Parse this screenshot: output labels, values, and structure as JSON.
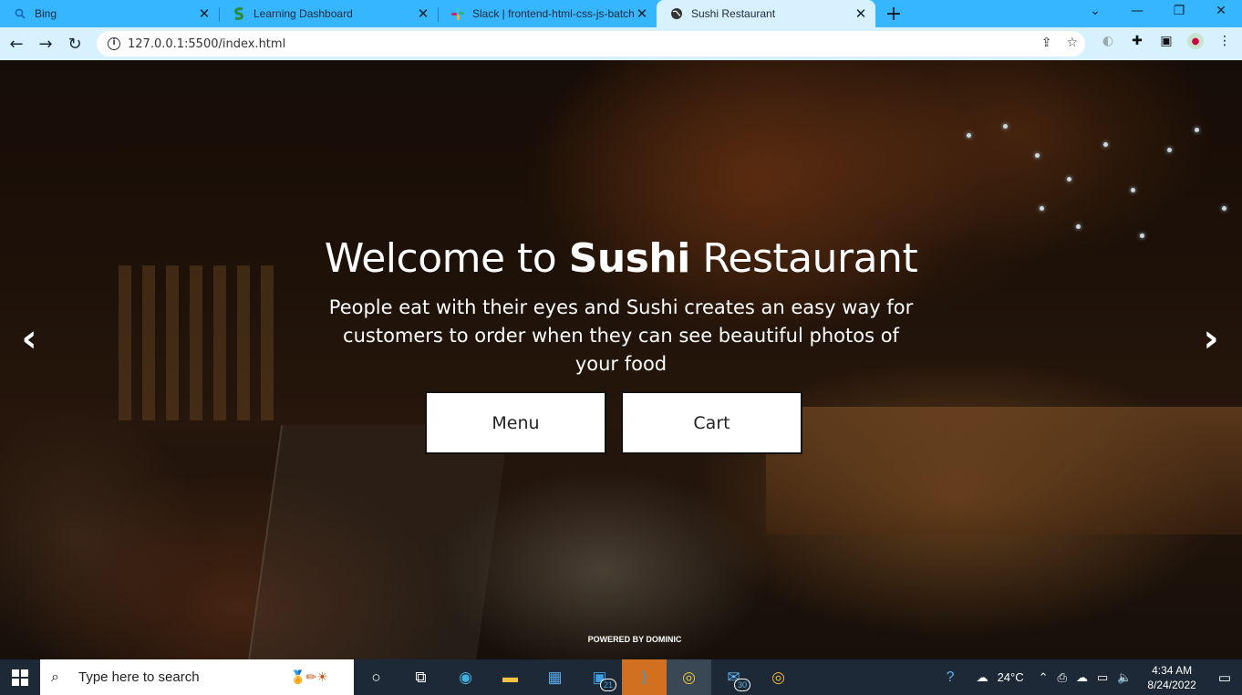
{
  "browser": {
    "tabs": [
      {
        "title": "Bing",
        "icon": "search-icon"
      },
      {
        "title": "Learning Dashboard",
        "icon": "s-logo-icon"
      },
      {
        "title": "Slack | frontend-html-css-js-batch",
        "icon": "slack-icon"
      },
      {
        "title": "Sushi Restaurant",
        "icon": "globe-icon",
        "active": true
      }
    ],
    "url": "127.0.0.1:5500/index.html"
  },
  "hero": {
    "title_pre": "Welcome to ",
    "title_bold": "Sushi",
    "title_post": " Restaurant",
    "subtitle": "People eat with their eyes and Sushi creates an easy way for customers to order when they can see beautiful photos of your food",
    "buttons": {
      "menu": "Menu",
      "cart": "Cart"
    },
    "powered_by": "POWERED BY DOMINIC"
  },
  "taskbar": {
    "search_placeholder": "Type here to search",
    "badges": {
      "teams": "21",
      "mail": "30"
    },
    "weather": "24°C",
    "time": "4:34 AM",
    "date": "8/24/2022"
  }
}
